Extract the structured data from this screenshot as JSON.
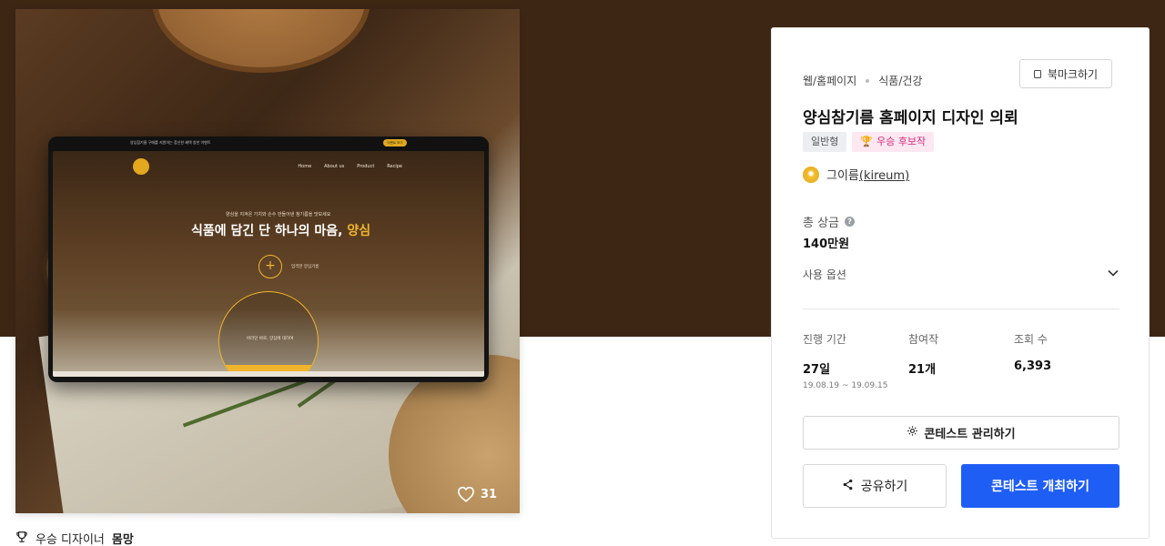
{
  "colors": {
    "accent_blue": "#1f5ef5",
    "award_pink": "#d42a7c",
    "hero_band": "#3e2615",
    "gold": "#f0b52c"
  },
  "hero": {
    "likes_count": "31",
    "mockup": {
      "notice": "양심참기름 구매를 지원하는 참신한 혜택 칭찬 이벤트",
      "pill": "이벤트 보기",
      "nav": [
        "Home",
        "About us",
        "Product",
        "Recipe"
      ],
      "small_copy": "양심을 지켜온 가치와 손수 만들어낸 참기름을 맛보세요",
      "headline_prefix": "식품에 담긴 단 하나의 마음, ",
      "headline_accent": "양심",
      "side_label": "엄격한 양심기름",
      "drop_text": "바라던 바로, 양심에 대하여"
    }
  },
  "winner": {
    "label": "우승 디자이너",
    "name": "몸망"
  },
  "card": {
    "category_1": "웹/홈페이지",
    "category_2": "식품/건강",
    "bookmark_label": "북마크하기",
    "title": "양심참기름 홈페이지 디자인 의뢰",
    "tag_general": "일반형",
    "tag_award": "우승 후보작",
    "designer_name": "그이름",
    "designer_handle": "(kireum)",
    "prize_label": "총 상금",
    "prize_value": "140만원",
    "options_label": "사용 옵션",
    "stats": [
      {
        "label": "진행 기간",
        "value": "27일",
        "sub": "19.08.19 ~ 19.09.15"
      },
      {
        "label": "참여작",
        "value": "21개",
        "sub": ""
      },
      {
        "label": "조회 수",
        "value": "6,393",
        "sub": ""
      }
    ],
    "manage_label": "콘테스트 관리하기",
    "share_label": "공유하기",
    "host_label": "콘테스트 개최하기"
  }
}
